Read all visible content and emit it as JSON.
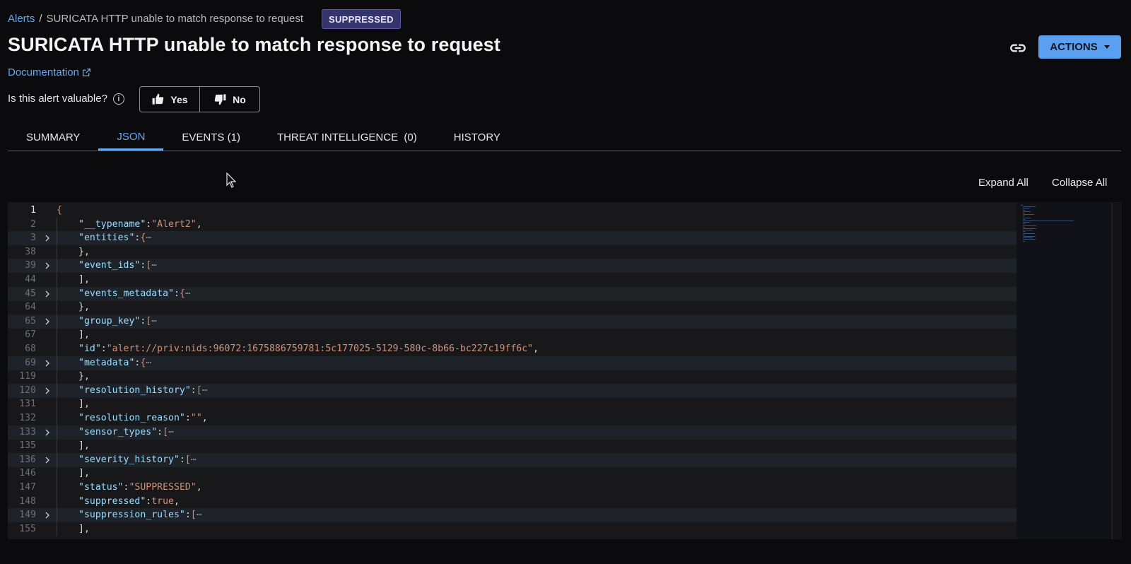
{
  "breadcrumb": {
    "root": "Alerts",
    "separator": "/",
    "current": "SURICATA HTTP unable to match response to request"
  },
  "status_badge": "SUPPRESSED",
  "title": "SURICATA HTTP unable to match response to request",
  "documentation_link": "Documentation",
  "feedback": {
    "question": "Is this alert valuable?",
    "yes_label": "Yes",
    "no_label": "No"
  },
  "actions_label": "ACTIONS",
  "tabs": [
    {
      "label": "SUMMARY",
      "active": false
    },
    {
      "label": "JSON",
      "active": true
    },
    {
      "label": "EVENTS (1)",
      "active": false
    },
    {
      "label": "THREAT INTELLIGENCE  (0)",
      "active": false
    },
    {
      "label": "HISTORY",
      "active": false
    }
  ],
  "json_controls": {
    "expand_all": "Expand All",
    "collapse_all": "Collapse All"
  },
  "json_lines": [
    {
      "num": "1",
      "foldable": false,
      "key": "",
      "value": "",
      "open": "{",
      "indent": 0,
      "current": true
    },
    {
      "num": "2",
      "foldable": false,
      "key": "\"__typename\"",
      "value": "\"Alert2\"",
      "value_type": "string",
      "trail": ",",
      "indent": 1
    },
    {
      "num": "3",
      "foldable": true,
      "key": "\"entities\"",
      "open": "{",
      "indent": 1
    },
    {
      "num": "38",
      "foldable": false,
      "close": "},",
      "indent": 1
    },
    {
      "num": "39",
      "foldable": true,
      "key": "\"event_ids\"",
      "open": "[",
      "indent": 1
    },
    {
      "num": "44",
      "foldable": false,
      "close": "],",
      "indent": 1
    },
    {
      "num": "45",
      "foldable": true,
      "key": "\"events_metadata\"",
      "open": "{",
      "indent": 1
    },
    {
      "num": "64",
      "foldable": false,
      "close": "},",
      "indent": 1
    },
    {
      "num": "65",
      "foldable": true,
      "key": "\"group_key\"",
      "open": "[",
      "indent": 1
    },
    {
      "num": "67",
      "foldable": false,
      "close": "],",
      "indent": 1
    },
    {
      "num": "68",
      "foldable": false,
      "key": "\"id\"",
      "value": "\"alert://priv:nids:96072:1675886759781:5c177025-5129-580c-8b66-bc227c19ff6c\"",
      "value_type": "string",
      "trail": ",",
      "indent": 1
    },
    {
      "num": "69",
      "foldable": true,
      "key": "\"metadata\"",
      "open": "{",
      "indent": 1
    },
    {
      "num": "119",
      "foldable": false,
      "close": "},",
      "indent": 1
    },
    {
      "num": "120",
      "foldable": true,
      "key": "\"resolution_history\"",
      "open": "[",
      "indent": 1
    },
    {
      "num": "131",
      "foldable": false,
      "close": "],",
      "indent": 1
    },
    {
      "num": "132",
      "foldable": false,
      "key": "\"resolution_reason\"",
      "value": "\"\"",
      "value_type": "string",
      "trail": ",",
      "indent": 1
    },
    {
      "num": "133",
      "foldable": true,
      "key": "\"sensor_types\"",
      "open": "[",
      "indent": 1
    },
    {
      "num": "135",
      "foldable": false,
      "close": "],",
      "indent": 1
    },
    {
      "num": "136",
      "foldable": true,
      "key": "\"severity_history\"",
      "open": "[",
      "indent": 1
    },
    {
      "num": "146",
      "foldable": false,
      "close": "],",
      "indent": 1
    },
    {
      "num": "147",
      "foldable": false,
      "key": "\"status\"",
      "value": "\"SUPPRESSED\"",
      "value_type": "string",
      "trail": ",",
      "indent": 1
    },
    {
      "num": "148",
      "foldable": false,
      "key": "\"suppressed\"",
      "value": "true",
      "value_type": "boolean",
      "trail": ",",
      "indent": 1
    },
    {
      "num": "149",
      "foldable": true,
      "key": "\"suppression_rules\"",
      "open": "[",
      "indent": 1
    },
    {
      "num": "155",
      "foldable": false,
      "close": "],",
      "indent": 1
    }
  ],
  "colors": {
    "accent": "#6aa8f0",
    "badge_bg": "#34336c",
    "actions_bg": "#5b9ff0",
    "json_key": "#9cdcfe",
    "json_string": "#ce9178"
  }
}
